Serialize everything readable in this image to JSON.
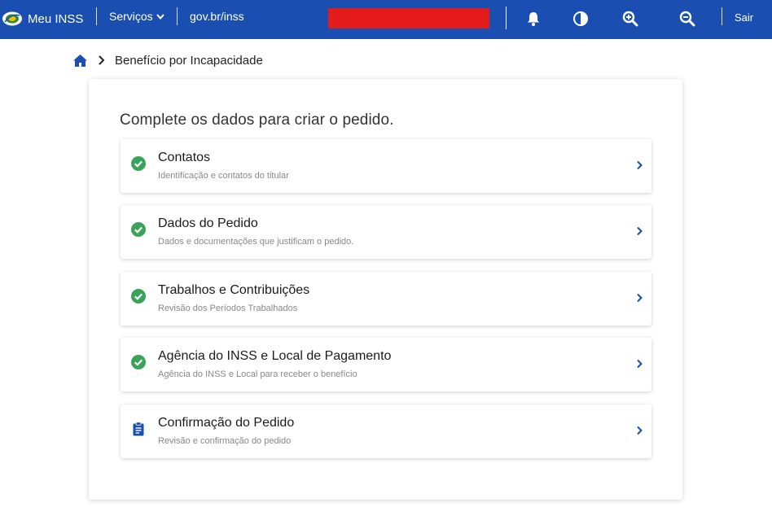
{
  "header": {
    "app_name": "Meu INSS",
    "services_label": "Serviços",
    "govbr_label": "gov.br/inss",
    "logout_label": "Sair",
    "background_color": "#1a4eb0",
    "icons": [
      "bell-icon",
      "contrast-icon",
      "zoom-in-icon",
      "zoom-out-icon"
    ]
  },
  "breadcrumb": {
    "home_icon": "home-icon",
    "current": "Benefício por Incapacidade"
  },
  "main": {
    "title": "Complete os dados para criar o pedido.",
    "steps": [
      {
        "title": "Contatos",
        "subtitle": "Identificação e contatos do titular",
        "status": "complete",
        "icon": "check-circle-icon"
      },
      {
        "title": "Dados do Pedido",
        "subtitle": "Dados e documentações que justificam o pedido.",
        "status": "complete",
        "icon": "check-circle-icon"
      },
      {
        "title": "Trabalhos e Contribuições",
        "subtitle": "Revisão dos Períodos Trabalhados",
        "status": "complete",
        "icon": "check-circle-icon"
      },
      {
        "title": "Agência do INSS e Local de Pagamento",
        "subtitle": "Agência do INSS e Local para receber o benefício",
        "status": "complete",
        "icon": "check-circle-icon"
      },
      {
        "title": "Confirmação do Pedido",
        "subtitle": "Revisão e confirmação do pedido",
        "status": "pending",
        "icon": "clipboard-icon"
      }
    ]
  },
  "colors": {
    "check": "#3aa35a",
    "link": "#1a4eb0",
    "redacted": "#e31b1b"
  }
}
